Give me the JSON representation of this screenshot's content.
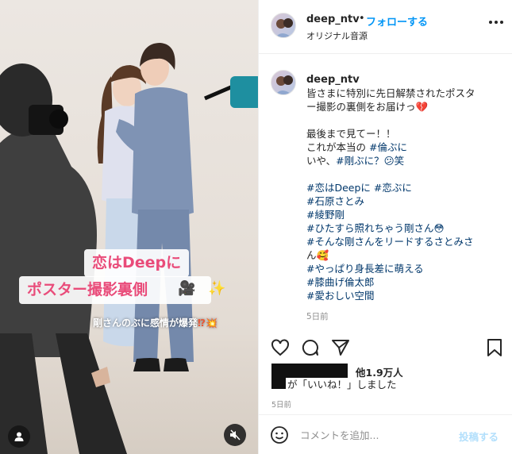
{
  "media": {
    "caption_line_1": "恋はDeepに",
    "caption_line_2": "ポスター撮影裏側",
    "sticker_icon": "movie-camera-icon",
    "sparkle_icon": "sparkles-icon",
    "subcaption": "剛さんのぶに感情が爆発",
    "subcaption_mark": "⁉💥",
    "user_tag_icon": "user-tag-icon",
    "mute_icon": "speaker-muted-icon"
  },
  "header": {
    "username": "deep_ntv",
    "dot": "•",
    "follow_label": "フォローする",
    "audio_label": "オリジナル音源",
    "more_icon": "more-horizontal-icon"
  },
  "caption": {
    "username": "deep_ntv",
    "suffix": ".",
    "lines": [
      "皆さまに特別に先日解禁されたポスタ",
      "ー撮影の裏側をお届けっ💔",
      "",
      "最後まで見てー！！",
      "これが本当の #倫ぶに",
      "いや、#剛ぶに？😕笑",
      "",
      "#恋はDeepに #恋ぶに",
      "#石原さとみ",
      "#綾野剛",
      "#ひたすら照れちゃう剛さん😳",
      "#そんな剛さんをリードするさとみさ",
      "ん🥰",
      "#やっぱり身長差に萌える",
      "#膝曲げ倫太郎",
      "#愛おしい空間"
    ],
    "time": "5日前"
  },
  "actions": {
    "like_icon": "heart-icon",
    "comment_icon": "comment-icon",
    "share_icon": "paper-plane-icon",
    "save_icon": "bookmark-icon"
  },
  "likes": {
    "count": "他1.9万人",
    "line2": "が「いいね！」しました"
  },
  "post_time": "5日前",
  "comment_bar": {
    "emoji_icon": "smiley-icon",
    "placeholder": "コメントを追加...",
    "post_label": "投稿する"
  },
  "colors": {
    "accent": "#0095f6",
    "caption_pink": "#e94c7a",
    "hashtag": "#00376b",
    "muted": "#8e8e8e"
  }
}
